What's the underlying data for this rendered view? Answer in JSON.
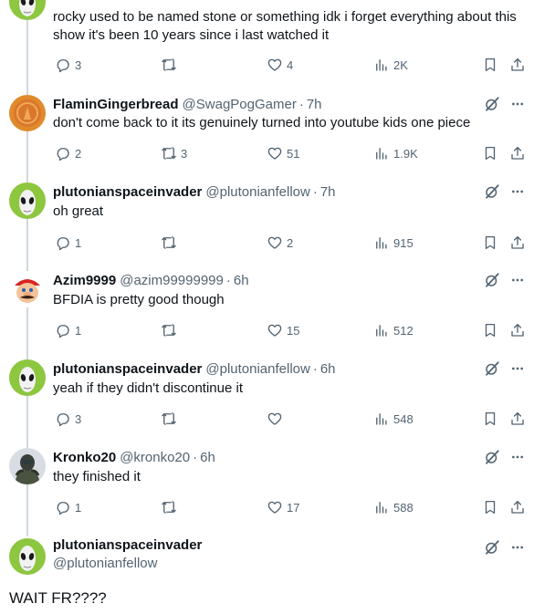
{
  "tweets": [
    {
      "name": "",
      "handle": "",
      "time": "",
      "text": "rocky used to be named stone or something idk i forget everything about this show it's been 10 years since i last watched it",
      "replies": "3",
      "retweets": "",
      "likes": "4",
      "views": "2K",
      "avatar": "alien-avatar"
    },
    {
      "name": "FlaminGingerbread",
      "handle": "@SwagPogGamer",
      "time": "7h",
      "text": "don't come back to it its genuinely turned into youtube kids one piece",
      "replies": "2",
      "retweets": "3",
      "likes": "51",
      "views": "1.9K",
      "avatar": "orange-coin-avatar"
    },
    {
      "name": "plutonianspaceinvader",
      "handle": "@plutonianfellow",
      "time": "7h",
      "text": "oh great",
      "replies": "1",
      "retweets": "",
      "likes": "2",
      "views": "915",
      "avatar": "alien-avatar"
    },
    {
      "name": "Azim9999",
      "handle": "@azim99999999",
      "time": "6h",
      "text": "BFDIA is pretty good though",
      "replies": "1",
      "retweets": "",
      "likes": "15",
      "views": "512",
      "avatar": "mario-avatar"
    },
    {
      "name": "plutonianspaceinvader",
      "handle": "@plutonianfellow",
      "time": "6h",
      "text": "yeah if they didn't discontinue it",
      "replies": "3",
      "retweets": "",
      "likes": "",
      "views": "548",
      "avatar": "alien-avatar"
    },
    {
      "name": "Kronko20",
      "handle": "@kronko20",
      "time": "6h",
      "text": "they finished it",
      "replies": "1",
      "retweets": "",
      "likes": "17",
      "views": "588",
      "avatar": "soldier-avatar"
    }
  ],
  "focused": {
    "name": "plutonianspaceinvader",
    "handle": "@plutonianfellow",
    "text": "WAIT FR????"
  },
  "colors": {
    "text": "#0f1419",
    "muted": "#536471",
    "line": "#cfd9de",
    "alien": "#8dc63f"
  },
  "icons": [
    "reply-icon",
    "retweet-icon",
    "like-icon",
    "views-icon",
    "bookmark-icon",
    "share-icon",
    "grok-icon",
    "more-icon"
  ]
}
